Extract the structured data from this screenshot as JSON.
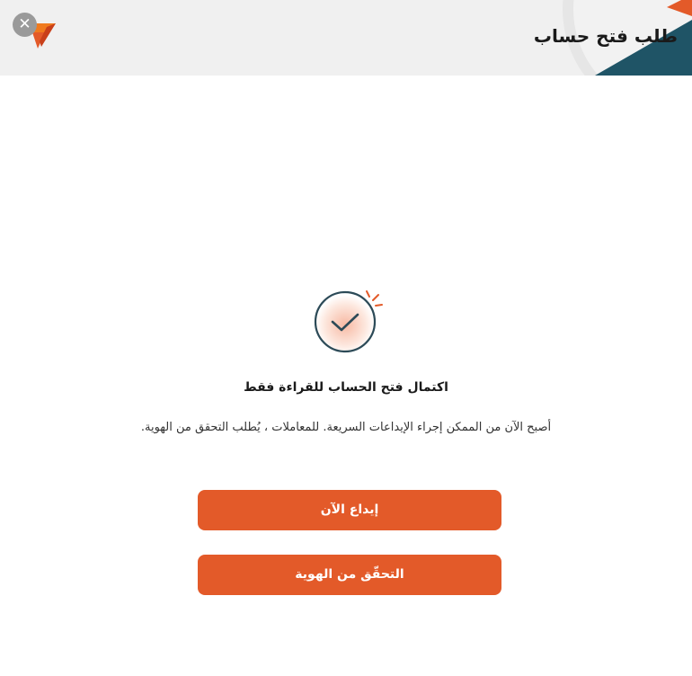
{
  "header": {
    "title": "طلب فتح حساب",
    "close_icon": "close-icon",
    "logo_icon": "brand-logo-icon"
  },
  "colors": {
    "accent": "#e35a29",
    "header_bg": "#f0f0f0",
    "teal": "#1f5466",
    "icon_stroke": "#2c4a57"
  },
  "content": {
    "icon": "check-icon",
    "title": "اكتمال فتح الحساب للقراءة فقط",
    "description": "أصبح الآن من الممكن إجراء الإيداعات السريعة. للمعاملات ، يُطلب التحقق من الهوية."
  },
  "buttons": {
    "deposit_label": "إيداع الآن",
    "verify_label": "التحقّق من الهوية"
  }
}
